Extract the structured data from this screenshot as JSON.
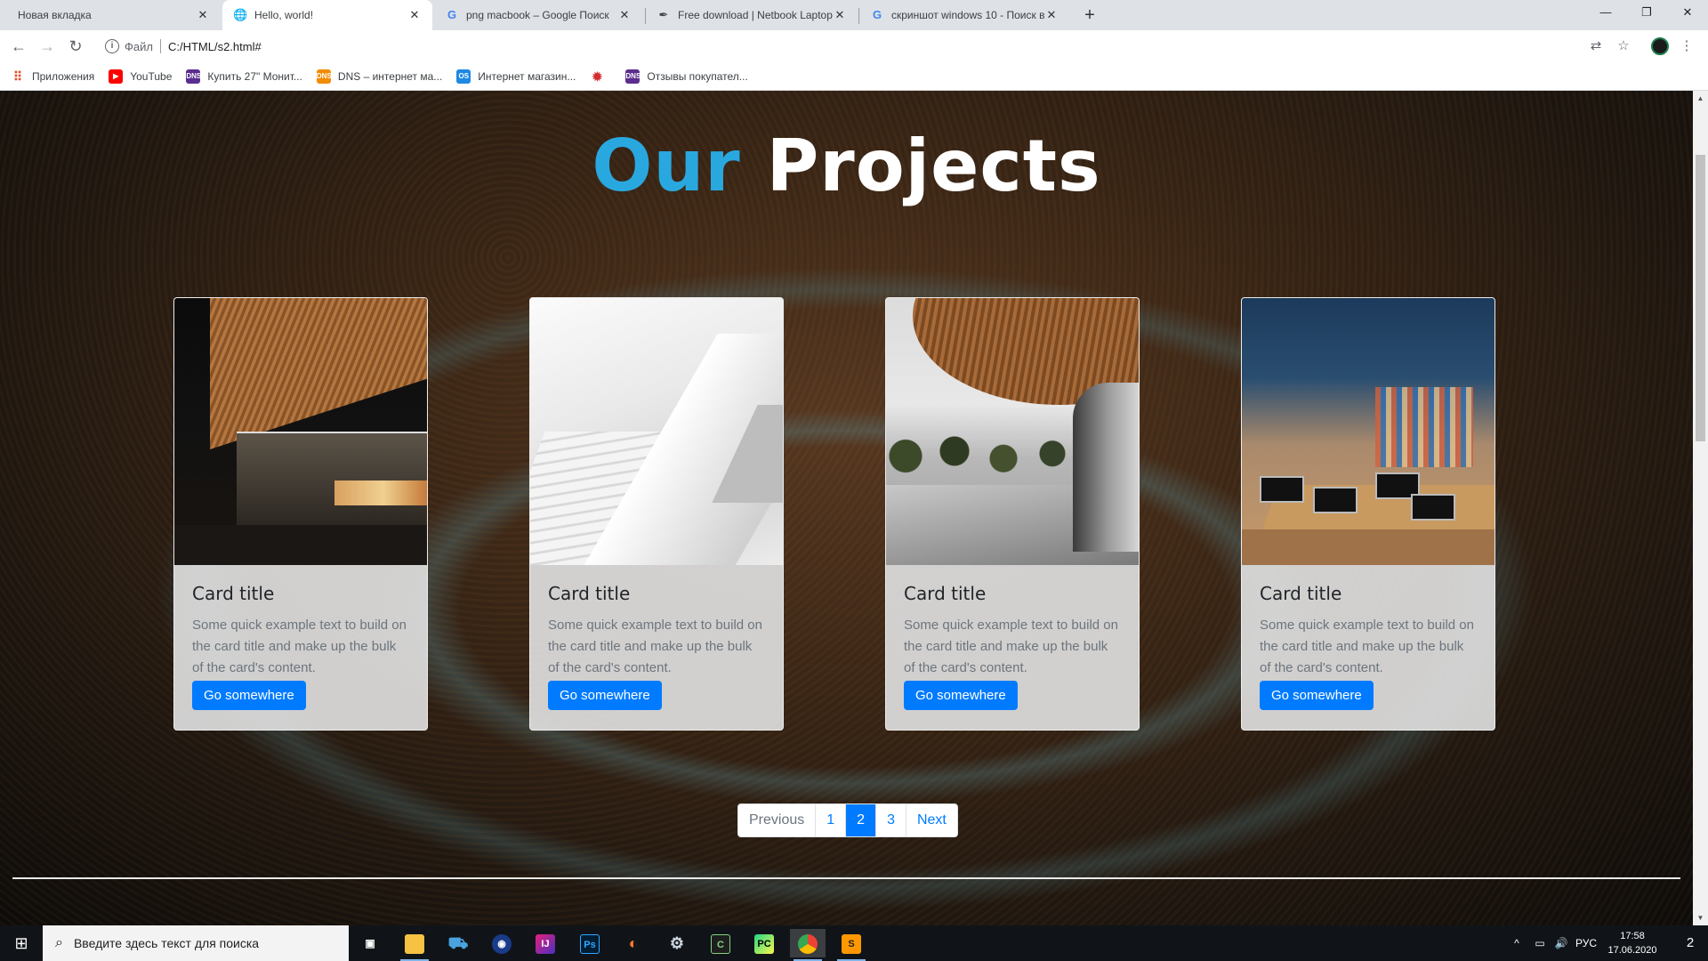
{
  "browser": {
    "tabs": [
      {
        "title": "Новая вкладка",
        "active": false,
        "favicon": "none"
      },
      {
        "title": "Hello, world!",
        "active": true,
        "favicon": "globe-icon"
      },
      {
        "title": "png macbook – Google Поиск",
        "active": false,
        "favicon": "google-icon"
      },
      {
        "title": "Free download | Netbook Laptop",
        "active": false,
        "favicon": "feather-icon"
      },
      {
        "title": "скриншот windows 10 - Поиск в",
        "active": false,
        "favicon": "google-icon"
      }
    ],
    "new_tab_symbol": "+",
    "window_controls": {
      "minimize": "—",
      "maximize": "❐",
      "close": "✕"
    },
    "address": {
      "scheme": "Файл",
      "path": "C:/HTML/s2.html#"
    },
    "bookmarks": [
      {
        "label": "Приложения",
        "icon": "apps-grid-icon",
        "color": "#e44d26"
      },
      {
        "label": "YouTube",
        "icon": "youtube-icon",
        "color": "#ff0000"
      },
      {
        "label": "Купить 27\" Монит...",
        "icon": "dns-icon",
        "color": "#5b2d8e"
      },
      {
        "label": "DNS – интернет ма...",
        "icon": "dns-orange-icon",
        "color": "#f28c00"
      },
      {
        "label": "Интернет магазин...",
        "icon": "os-icon",
        "color": "#1e88e5"
      },
      {
        "label": "",
        "icon": "gear-red-icon",
        "color": "#d32f2f"
      },
      {
        "label": "Отзывы покупател...",
        "icon": "dns-icon",
        "color": "#5b2d8e"
      }
    ]
  },
  "page": {
    "title_accent": "Our",
    "title_main": "Projects",
    "accent_color": "#29a8e0",
    "cards": [
      {
        "title": "Card title",
        "text": "Some quick example text to build on the card title and make up the bulk of the card's content.",
        "button": "Go somewhere"
      },
      {
        "title": "Card title",
        "text": "Some quick example text to build on the card title and make up the bulk of the card's content.",
        "button": "Go somewhere"
      },
      {
        "title": "Card title",
        "text": "Some quick example text to build on the card title and make up the bulk of the card's content.",
        "button": "Go somewhere"
      },
      {
        "title": "Card title",
        "text": "Some quick example text to build on the card title and make up the bulk of the card's content.",
        "button": "Go somewhere"
      }
    ],
    "pagination": {
      "previous": "Previous",
      "pages": [
        "1",
        "2",
        "3"
      ],
      "active_page": "2",
      "next": "Next"
    }
  },
  "taskbar": {
    "search_placeholder": "Введите здесь текст для поиска",
    "language": "РУС",
    "time": "17:58",
    "date": "17.06.2020",
    "notifications_count": "2"
  }
}
